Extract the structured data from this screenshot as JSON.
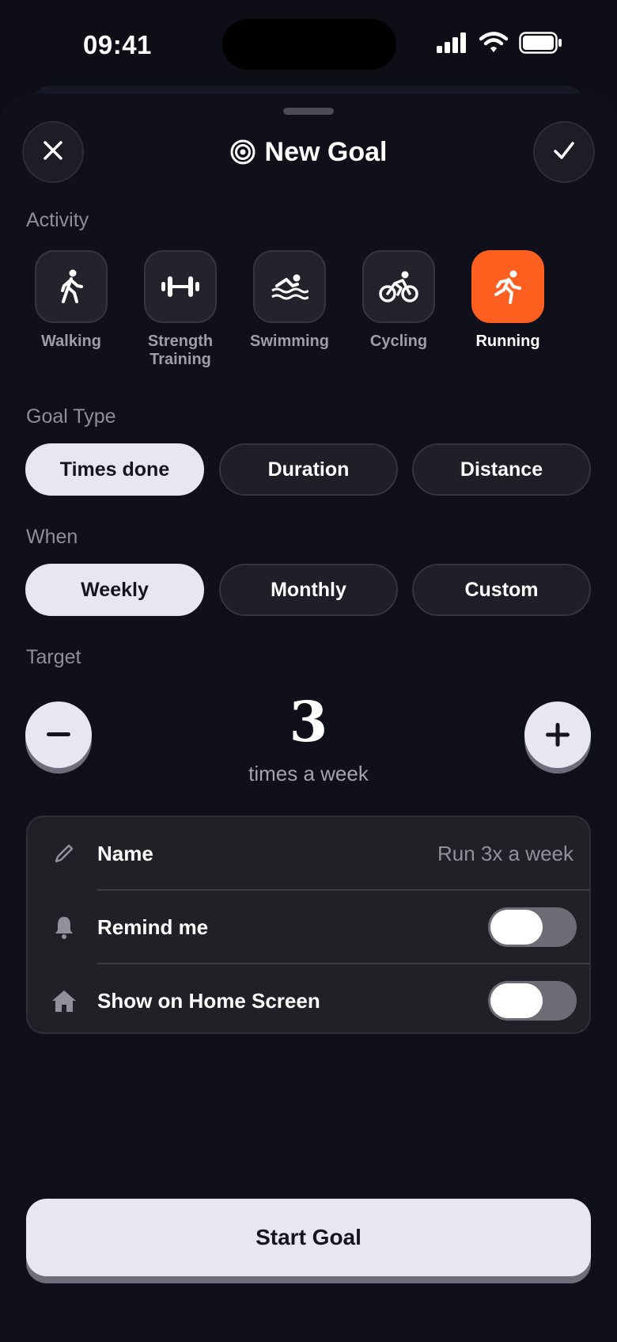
{
  "status_bar": {
    "time": "09:41"
  },
  "header": {
    "title": "New Goal"
  },
  "sections": {
    "activity": "Activity",
    "goal_type": "Goal Type",
    "when": "When",
    "target": "Target"
  },
  "activities": [
    {
      "label": "Walking",
      "icon": "walking-icon",
      "selected": false
    },
    {
      "label": "Strength Training",
      "icon": "dumbbell-icon",
      "selected": false
    },
    {
      "label": "Swimming",
      "icon": "swimming-icon",
      "selected": false
    },
    {
      "label": "Cycling",
      "icon": "cycling-icon",
      "selected": false
    },
    {
      "label": "Running",
      "icon": "running-icon",
      "selected": true
    }
  ],
  "goal_types": [
    {
      "label": "Times done",
      "selected": true
    },
    {
      "label": "Duration",
      "selected": false
    },
    {
      "label": "Distance",
      "selected": false
    }
  ],
  "when_options": [
    {
      "label": "Weekly",
      "selected": true
    },
    {
      "label": "Monthly",
      "selected": false
    },
    {
      "label": "Custom",
      "selected": false
    }
  ],
  "target": {
    "value": "3",
    "unit": "times a week"
  },
  "settings": {
    "name_label": "Name",
    "name_value": "Run 3x a week",
    "remind_label": "Remind me",
    "remind_on": true,
    "home_label": "Show on Home Screen",
    "home_on": true
  },
  "start_button": "Start Goal",
  "colors": {
    "accent": "#ff5f1f",
    "background": "#0f1019",
    "pill_selected": "#e8e7f1"
  }
}
